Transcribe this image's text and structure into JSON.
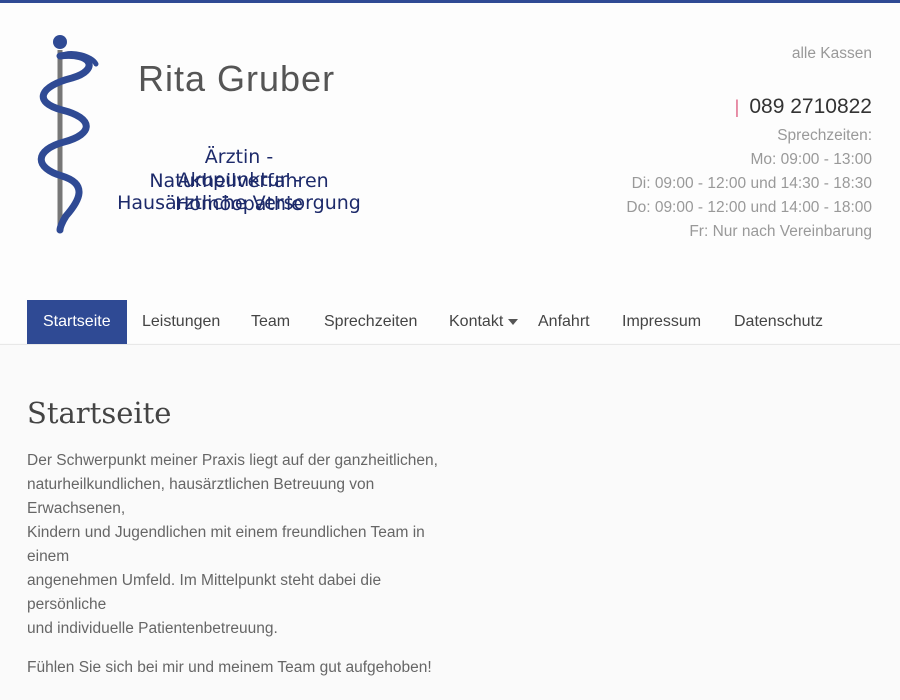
{
  "logo": {
    "name": "Rita Gruber",
    "lines": [
      "Ärztin - Naturheilverfahren",
      "Akupunktur - Homöopathie",
      "Hausärztliche Versorgung"
    ]
  },
  "header": {
    "insurance": "alle Kassen",
    "phone": "089 2710822",
    "hours_label": "Sprechzeiten:",
    "hours": [
      "Mo: 09:00 - 13:00",
      "Di: 09:00 - 12:00 und 14:30 - 18:30",
      "Do: 09:00 - 12:00 und 14:00 - 18:00",
      "Fr: Nur nach Vereinbarung"
    ]
  },
  "nav": {
    "items": [
      {
        "label": "Startseite",
        "active": true
      },
      {
        "label": "Leistungen"
      },
      {
        "label": "Team"
      },
      {
        "label": "Sprechzeiten"
      },
      {
        "label": "Kontakt",
        "has_dropdown": true
      },
      {
        "label": "Anfahrt"
      },
      {
        "label": "Impressum"
      },
      {
        "label": "Datenschutz"
      }
    ]
  },
  "content": {
    "title": "Startseite",
    "paragraph1_lines": [
      "Der Schwerpunkt meiner Praxis liegt auf der ganzheitlichen,",
      "naturheilkundlichen, hausärztlichen Betreuung von",
      "Erwachsenen,",
      "Kindern und Jugendlichen mit einem freundlichen Team in",
      "einem",
      "angenehmen Umfeld. Im Mittelpunkt steht dabei die",
      "persönliche",
      "und individuelle Patientenbetreuung."
    ],
    "paragraph2": "Fühlen Sie sich bei mir und meinem Team gut aufgehoben!"
  },
  "colors": {
    "accent": "#2f4a94",
    "logo_text": "#1d2a6a",
    "phone_pipe": "#e06a8a"
  }
}
